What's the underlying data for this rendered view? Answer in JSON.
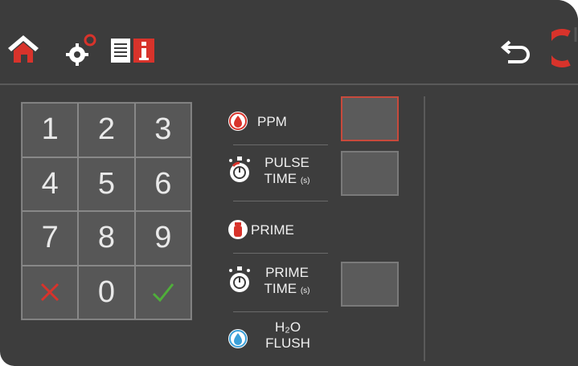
{
  "header": {
    "icons": [
      "home-icon",
      "gear-icon",
      "info-icon",
      "back-icon",
      "power-icon"
    ]
  },
  "keypad": {
    "keys": [
      "1",
      "2",
      "3",
      "4",
      "5",
      "6",
      "7",
      "8",
      "9",
      "✕",
      "0",
      "✓"
    ],
    "cancel_color": "#d8332b",
    "confirm_color": "#4fae3a"
  },
  "params": {
    "ppm": {
      "label": "PPM"
    },
    "pulse_time": {
      "line1": "PULSE",
      "line2": "TIME",
      "unit": "(s)"
    },
    "prime": {
      "label": "PRIME"
    },
    "prime_time": {
      "line1": "PRIME",
      "line2": "TIME",
      "unit": "(s)"
    },
    "flush": {
      "line1": "H₂O",
      "line2": "FLUSH"
    }
  },
  "colors": {
    "accent": "#d8332b",
    "background": "#3d3d3d"
  }
}
